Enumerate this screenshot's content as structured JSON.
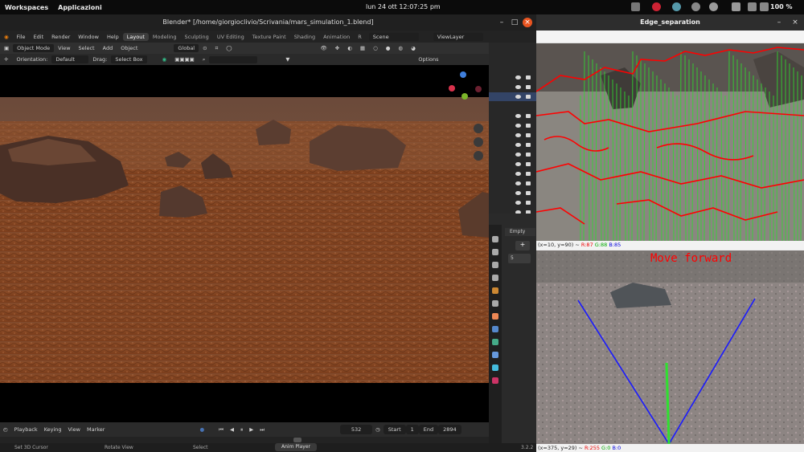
{
  "topbar": {
    "workspaces": "Workspaces",
    "apps": "Applicazioni",
    "clock": "lun 24 ott  12:07:25 pm",
    "battery": "100 %"
  },
  "blender": {
    "title": "Blender* [/home/giorgioclivio/Scrivania/mars_simulation_1.blend]",
    "menus": [
      "File",
      "Edit",
      "Render",
      "Window",
      "Help"
    ],
    "workspace_tabs": [
      "Layout",
      "Modeling",
      "Sculpting",
      "UV Editing",
      "Texture Paint",
      "Shading",
      "Animation",
      "R"
    ],
    "active_tab": "Layout",
    "scene": "Scene",
    "view_layer": "ViewLayer",
    "header3d": {
      "mode": "Object Mode",
      "menus": [
        "View",
        "Select",
        "Add",
        "Object"
      ],
      "transform": "Global"
    },
    "toolopts": {
      "orientation_label": "Orientation:",
      "orientation": "Default",
      "drag_label": "Drag:",
      "drag": "Select Box",
      "options": "Options"
    },
    "timeline": {
      "playback": "Playback",
      "keying": "Keying",
      "view": "View",
      "marker": "Marker",
      "current_frame": "532",
      "start_label": "Start",
      "start": "1",
      "end_label": "End",
      "end": "2894"
    },
    "statusbar": {
      "set_cursor": "Set 3D Cursor",
      "rotate": "Rotate View",
      "select": "Select",
      "anim": "Anim Player",
      "version": "3.2.2"
    },
    "props": {
      "object_name": "Empty",
      "value": "5"
    }
  },
  "cv": {
    "window_title": "Edge_separation",
    "info1": {
      "prefix": "(x=10, y=90) ~ ",
      "r": "R:87",
      "g": "G:88",
      "b": "B:85"
    },
    "info2": {
      "prefix": "(x=375, y=29) ~ ",
      "r": "R:255",
      "g": "G:0",
      "b": "B:0"
    },
    "command": "Move forward"
  },
  "colors": {
    "blender_accent": "#4772b3",
    "edge_red": "#ff0000",
    "edge_green": "#2fdc2f",
    "guide_blue": "#1a1aff",
    "mars_ground": "#8a4a26"
  }
}
